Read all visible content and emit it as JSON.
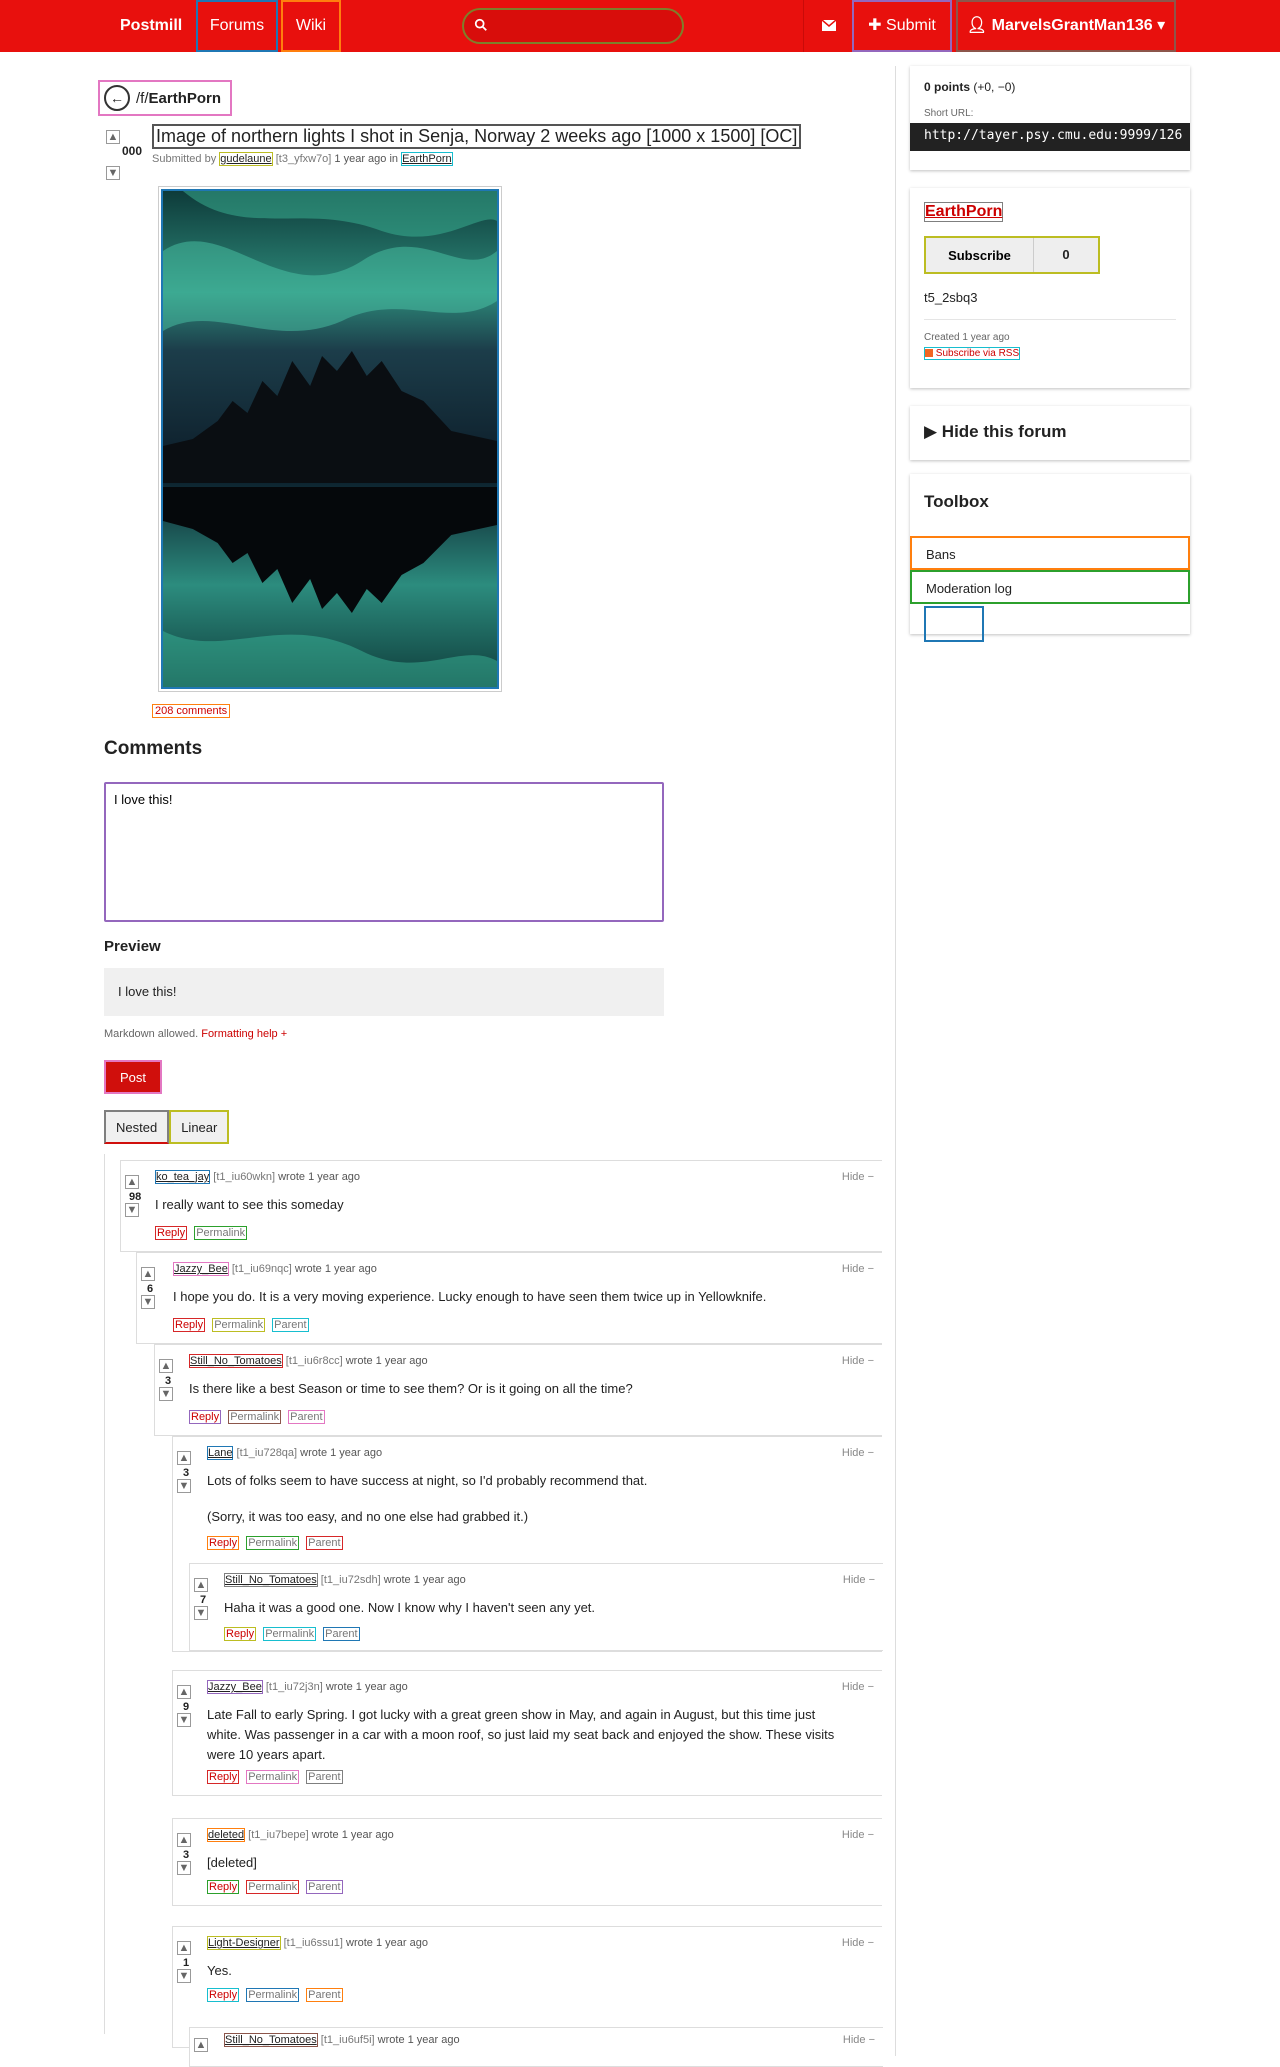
{
  "nav": {
    "brand": "Postmill",
    "forums": "Forums",
    "wiki": "Wiki",
    "search_placeholder": "",
    "submit": "Submit",
    "user": "MarvelsGrantMan136"
  },
  "post": {
    "back_prefix": "/f/",
    "back_forum": "EarthPorn",
    "score": "000",
    "title": "Image of northern lights I shot in Senja, Norway 2 weeks ago [1000 x 1500] [OC]",
    "submitted_by": "Submitted by",
    "author": "gudelaune",
    "id": "[t3_yfxw7o]",
    "age": "1 year ago in",
    "forum": "EarthPorn",
    "comments_link": "208 comments"
  },
  "composer": {
    "heading": "Comments",
    "text": "I love this!",
    "preview_heading": "Preview",
    "preview_text": "I love this!",
    "markdown_note": "Markdown allowed.",
    "formatting_help": "Formatting help +",
    "post_button": "Post",
    "nested": "Nested",
    "linear": "Linear"
  },
  "comments": [
    {
      "author": "ko_tea_jay",
      "id": "[t1_iu60wkn]",
      "wrote": "wrote 1 year ago",
      "score": "98",
      "body": "I really want to see this someday",
      "actions": [
        "Reply",
        "Permalink"
      ]
    },
    {
      "author": "Jazzy_Bee",
      "id": "[t1_iu69nqc]",
      "wrote": "wrote 1 year ago",
      "score": "6",
      "body": "I hope you do. It is a very moving experience. Lucky enough to have seen them twice up in Yellowknife.",
      "actions": [
        "Reply",
        "Permalink",
        "Parent"
      ]
    },
    {
      "author": "Still_No_Tomatoes",
      "id": "[t1_iu6r8cc]",
      "wrote": "wrote 1 year ago",
      "score": "3",
      "body": "Is there like a best Season or time to see them? Or is it going on all the time?",
      "actions": [
        "Reply",
        "Permalink",
        "Parent"
      ]
    },
    {
      "author": "Lane",
      "id": "[t1_iu728qa]",
      "wrote": "wrote 1 year ago",
      "score": "3",
      "body": "Lots of folks seem to have success at night, so I'd probably recommend that.",
      "body2": "(Sorry, it was too easy, and no one else had grabbed it.)",
      "actions": [
        "Reply",
        "Permalink",
        "Parent"
      ]
    },
    {
      "author": "Still_No_Tomatoes",
      "id": "[t1_iu72sdh]",
      "wrote": "wrote 1 year ago",
      "score": "7",
      "body": "Haha it was a good one. Now I know why I haven't seen any yet.",
      "actions": [
        "Reply",
        "Permalink",
        "Parent"
      ]
    },
    {
      "author": "Jazzy_Bee",
      "id": "[t1_iu72j3n]",
      "wrote": "wrote 1 year ago",
      "score": "9",
      "body": "Late Fall to early Spring. I got lucky with a great green show in May, and again in August, but this time just",
      "body2": "white. Was passenger in a car with a moon roof, so just laid my seat back and enjoyed the show. These visits",
      "body3": "were 10 years apart.",
      "actions": [
        "Reply",
        "Permalink",
        "Parent"
      ]
    },
    {
      "author": "deleted",
      "id": "[t1_iu7bepe]",
      "wrote": "wrote 1 year ago",
      "score": "3",
      "body": "[deleted]",
      "actions": [
        "Reply",
        "Permalink",
        "Parent"
      ]
    },
    {
      "author": "Light-Designer",
      "id": "[t1_iu6ssu1]",
      "wrote": "wrote 1 year ago",
      "score": "1",
      "body": "Yes.",
      "actions": [
        "Reply",
        "Permalink",
        "Parent"
      ]
    },
    {
      "author": "Still_No_Tomatoes",
      "id": "[t1_iu6uf5i]",
      "wrote": "wrote 1 year ago",
      "score": "",
      "body": "",
      "actions": []
    }
  ],
  "hide_label": "Hide −",
  "sidebar": {
    "points": "0 points",
    "points_detail": "(+0, −0)",
    "short_url_label": "Short URL:",
    "short_url": "http://tayer.psy.cmu.edu:9999/126",
    "forum_name": "EarthPorn",
    "subscribe": "Subscribe",
    "subscriber_count": "0",
    "forum_id": "t5_2sbq3",
    "created": "Created 1 year ago",
    "rss": "Subscribe via RSS",
    "hide_forum": "▶  Hide this forum",
    "toolbox": "Toolbox",
    "bans": "Bans",
    "moderation_log": "Moderation log"
  },
  "colors": {
    "nav": "#e8100d",
    "accent": "#cc0000"
  }
}
